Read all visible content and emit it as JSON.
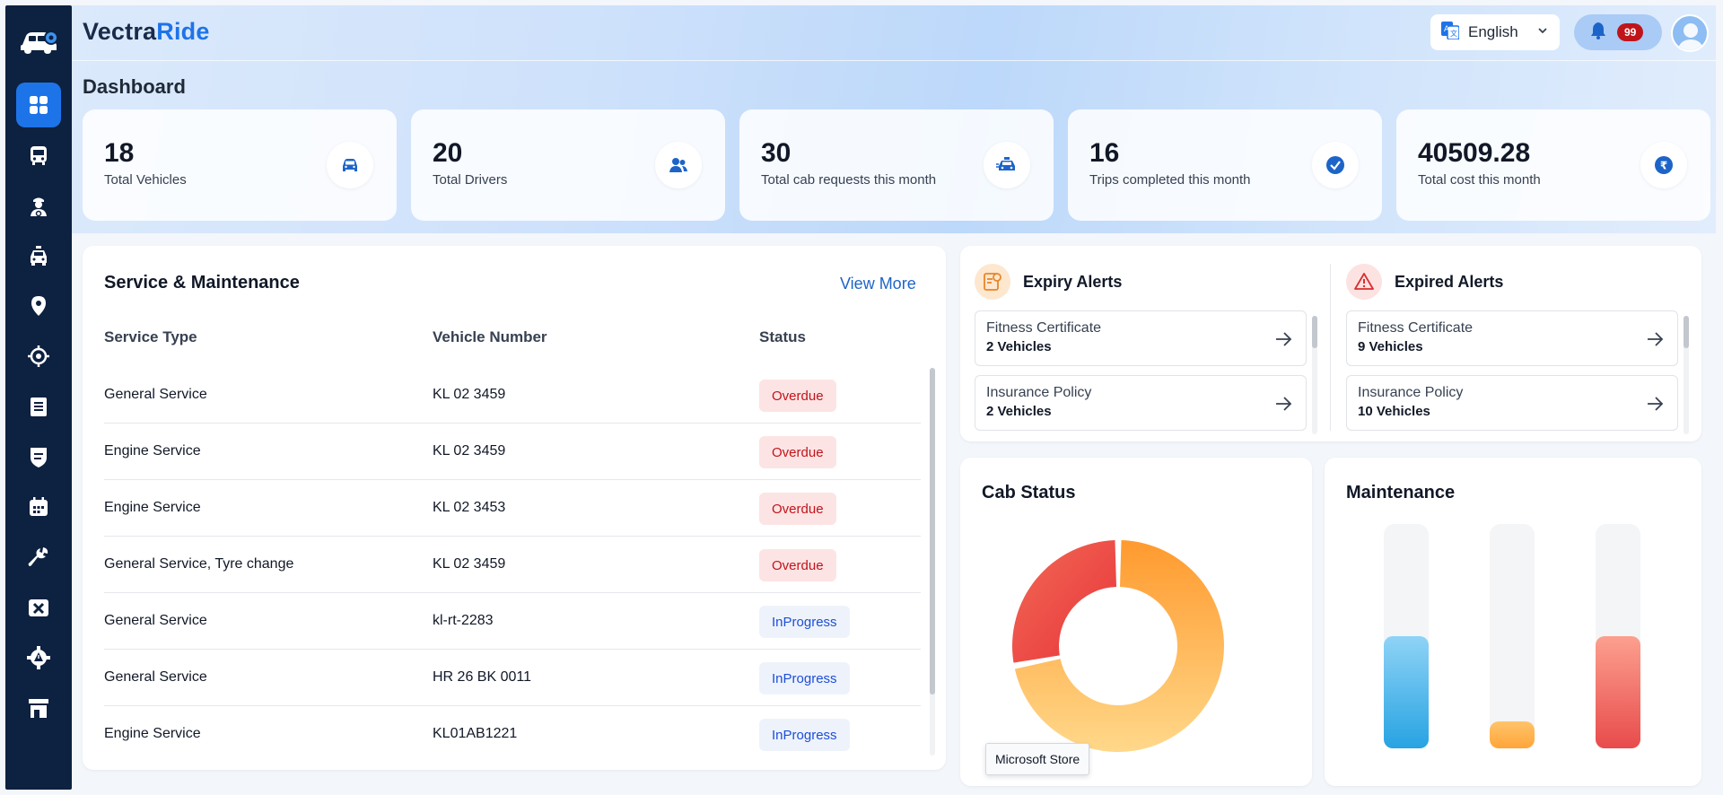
{
  "brand": {
    "part1": "Vectra",
    "part2": "Ride"
  },
  "page_title": "Dashboard",
  "language": {
    "selected": "English"
  },
  "notifications": {
    "count": "99"
  },
  "sidebar": {
    "items": [
      {
        "icon": "dashboard-icon",
        "active": true
      },
      {
        "icon": "bus-icon"
      },
      {
        "icon": "driver-icon"
      },
      {
        "icon": "cab-icon"
      },
      {
        "icon": "location-pin-icon"
      },
      {
        "icon": "crosshair-icon"
      },
      {
        "icon": "document-list-icon"
      },
      {
        "icon": "shield-icon"
      },
      {
        "icon": "calendar-icon"
      },
      {
        "icon": "wrench-icon"
      },
      {
        "icon": "vehicle-off-icon"
      },
      {
        "icon": "settings-alert-icon"
      },
      {
        "icon": "store-icon"
      }
    ]
  },
  "stats": [
    {
      "value": "18",
      "label": "Total Vehicles",
      "icon": "car-icon"
    },
    {
      "value": "20",
      "label": "Total Drivers",
      "icon": "users-icon"
    },
    {
      "value": "30",
      "label": "Total cab requests this month",
      "icon": "cab-request-icon"
    },
    {
      "value": "16",
      "label": "Trips completed this month",
      "icon": "check-circle-icon"
    },
    {
      "value": "40509.28",
      "label": "Total cost this month",
      "icon": "rupee-icon"
    }
  ],
  "service": {
    "title": "Service & Maintenance",
    "view_more": "View More",
    "columns": [
      "Service Type",
      "Vehicle Number",
      "Status"
    ],
    "rows": [
      {
        "type": "General Service",
        "vehicle": "KL 02 3459",
        "status": "Overdue"
      },
      {
        "type": "Engine Service",
        "vehicle": "KL 02 3459",
        "status": "Overdue"
      },
      {
        "type": "Engine Service",
        "vehicle": "KL 02 3453",
        "status": "Overdue"
      },
      {
        "type": "General Service, Tyre change",
        "vehicle": "KL 02 3459",
        "status": "Overdue"
      },
      {
        "type": "General Service",
        "vehicle": "kl-rt-2283",
        "status": "InProgress"
      },
      {
        "type": "General Service",
        "vehicle": "HR 26 BK 0011",
        "status": "InProgress"
      },
      {
        "type": "Engine Service",
        "vehicle": "KL01AB1221",
        "status": "InProgress"
      }
    ]
  },
  "expiry_alerts": {
    "title": "Expiry Alerts",
    "items": [
      {
        "name": "Fitness Certificate",
        "count": "2 Vehicles"
      },
      {
        "name": "Insurance Policy",
        "count": "2 Vehicles"
      }
    ]
  },
  "expired_alerts": {
    "title": "Expired Alerts",
    "items": [
      {
        "name": "Fitness Certificate",
        "count": "9 Vehicles"
      },
      {
        "name": "Insurance Policy",
        "count": "10 Vehicles"
      }
    ]
  },
  "cab_status": {
    "title": "Cab Status"
  },
  "maintenance": {
    "title": "Maintenance"
  },
  "tooltip": "Microsoft Store",
  "chart_data": [
    {
      "type": "pie",
      "values": [
        28,
        72
      ],
      "colors": [
        "#ec4545",
        "#ffa53a"
      ]
    },
    {
      "type": "bar",
      "values": [
        50,
        12,
        50
      ],
      "ylim": [
        0,
        100
      ],
      "colors": [
        "#2aa8e8",
        "#ffa53a",
        "#ec4f4f"
      ]
    }
  ]
}
